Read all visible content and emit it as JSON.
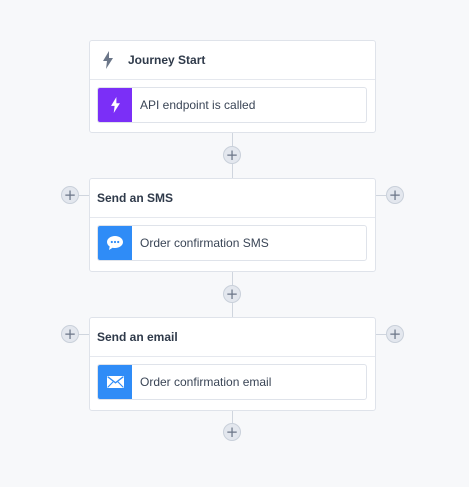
{
  "journey": {
    "start": {
      "title": "Journey Start",
      "title_icon": "lightning-icon",
      "step_label": "API endpoint is called",
      "step_icon": "lightning-icon",
      "step_color": "#7b2ff7"
    },
    "sms": {
      "title": "Send an SMS",
      "step_label": "Order confirmation SMS",
      "step_icon": "chat-bubble-icon",
      "step_color": "#2f8cf7"
    },
    "email": {
      "title": "Send an email",
      "step_label": "Order confirmation email",
      "step_icon": "envelope-icon",
      "step_color": "#2f8cf7"
    },
    "add_button_symbol": "+"
  }
}
